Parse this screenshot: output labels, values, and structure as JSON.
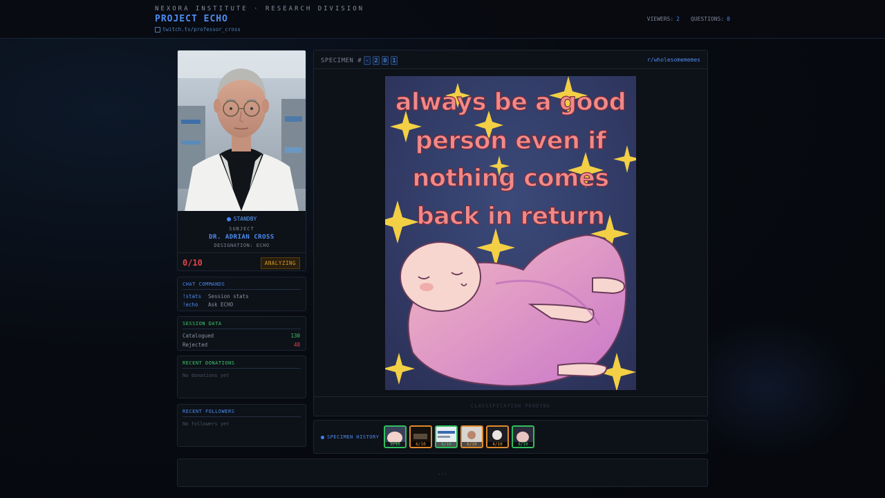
{
  "header": {
    "org": "NEXORA INSTITUTE · RESEARCH DIVISION",
    "project": "PROJECT ECHO",
    "channel": "twitch.tv/professor_cross",
    "viewers_label": "VIEWERS:",
    "viewers": "2",
    "questions_label": "QUESTIONS:",
    "questions": "0"
  },
  "subject": {
    "status": "STANDBY",
    "label": "SUBJECT",
    "name": "DR. ADRIAN CROSS",
    "designation": "DESIGNATION: ECHO",
    "score": "0/10",
    "state": "ANALYZING"
  },
  "commands": {
    "title": "CHAT COMMANDS",
    "items": [
      {
        "key": "!stats",
        "desc": "Session stats"
      },
      {
        "key": "!echo",
        "desc": "Ask ECHO"
      }
    ]
  },
  "session": {
    "title": "SESSION DATA",
    "catalogued_label": "Catalogued",
    "catalogued": "130",
    "rejected_label": "Rejected",
    "rejected": "48"
  },
  "donations": {
    "title": "RECENT DONATIONS",
    "empty": "No donations yet"
  },
  "followers": {
    "title": "RECENT FOLLOWERS",
    "empty": "No followers yet"
  },
  "specimen": {
    "label": "SPECIMEN #",
    "digits": [
      "-",
      "2",
      "0",
      "1"
    ],
    "source": "r/wholesomememes",
    "meme_lines": [
      "always be a good",
      "person even if",
      "nothing comes",
      "back in return"
    ],
    "classification": "CLASSIFICATION PENDING"
  },
  "history": {
    "title": "SPECIMEN HISTORY",
    "items": [
      {
        "score": "9/10",
        "status": "accepted"
      },
      {
        "score": "6/10",
        "status": "rejected"
      },
      {
        "score": "8/10",
        "status": "accepted"
      },
      {
        "score": "6/10",
        "status": "rejected"
      },
      {
        "score": "4/10",
        "status": "rejected"
      },
      {
        "score": "8/10",
        "status": "accepted"
      }
    ]
  },
  "footer": {
    "text": "..."
  },
  "colors": {
    "accent": "#4d8df0",
    "good": "#3ec96c",
    "bad": "#e2454a",
    "warn": "#d19a2e"
  }
}
